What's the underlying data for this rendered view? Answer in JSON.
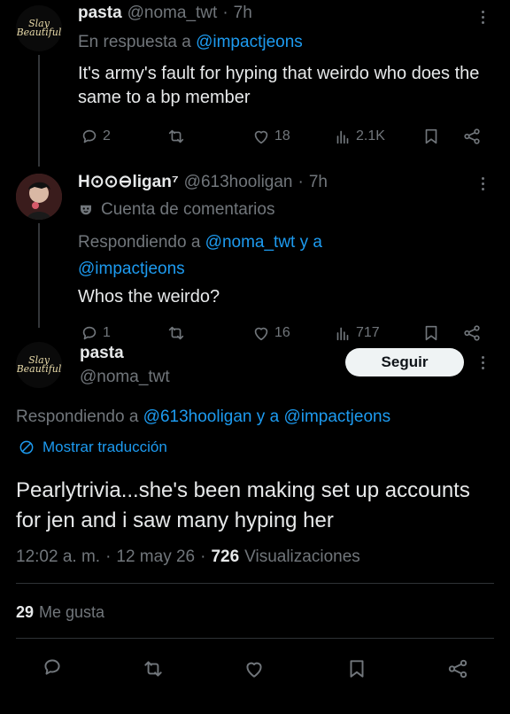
{
  "tweet1": {
    "avatar_logo": "Slay Beautiful",
    "display_name": "pasta",
    "handle": "@noma_twt",
    "separator": "·",
    "time": "7h",
    "reply_prefix": "En respuesta a",
    "reply_to": "@impactjeons",
    "text": "It's army's fault for hyping that weirdo who does the same to a bp member",
    "actions": {
      "replies": "2",
      "reposts": "",
      "likes": "18",
      "views": "2.1K"
    }
  },
  "tweet2": {
    "display_name": "H⊙⊙⊖ligan⁷",
    "handle": "@613hooligan",
    "separator": "·",
    "time": "7h",
    "account_label": "Cuenta de comentarios",
    "replying_prefix": "Respondiendo a",
    "replying_to_1": "@noma_twt",
    "replying_and": "y a",
    "replying_to_2": "@impactjeons",
    "text": "Whos the weirdo?",
    "actions": {
      "replies": "1",
      "reposts": "",
      "likes": "16",
      "views": "717"
    }
  },
  "main_tweet": {
    "avatar_logo": "Slay Beautiful",
    "display_name": "pasta",
    "handle": "@noma_twt",
    "follow_label": "Seguir",
    "replying_prefix": "Respondiendo a",
    "replying_to_1": "@613hooligan",
    "replying_and": "y a",
    "replying_to_2": "@impactjeons",
    "translate_label": "Mostrar traducción",
    "text": "Pearlytrivia...she's been making set up accounts for jen and i saw many hyping her",
    "timestamp": "12:02 a. m.",
    "dot1": "·",
    "date": "12 may 26",
    "dot2": "·",
    "views_count": "726",
    "views_label": "Visualizaciones",
    "likes_count": "29",
    "likes_label": "Me gusta"
  },
  "colors": {
    "background": "#000000",
    "text": "#e7e9ea",
    "muted": "#71767b",
    "link": "#1d9bf0"
  }
}
